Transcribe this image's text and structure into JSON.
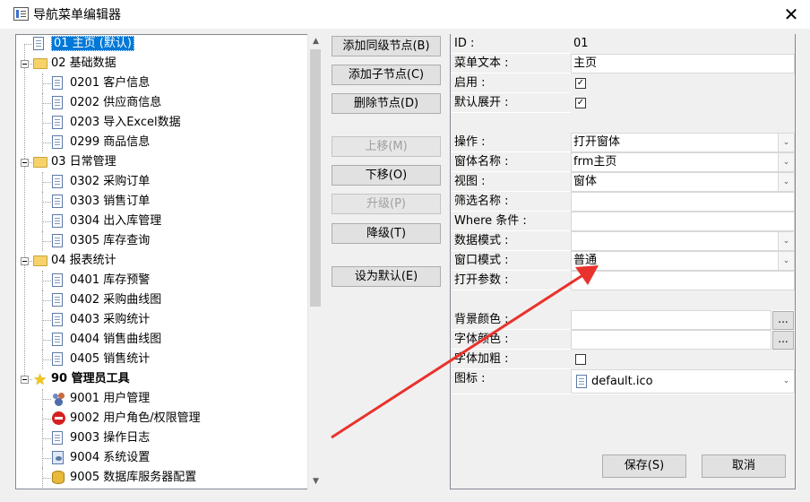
{
  "window": {
    "title": "导航菜单编辑器",
    "close_glyph": "✕"
  },
  "tree": {
    "selected": "01 主页 (默认)",
    "nodes": [
      {
        "label": "01 主页 (默认)"
      },
      {
        "label": "02 基础数据"
      },
      {
        "label": "0201 客户信息"
      },
      {
        "label": "0202 供应商信息"
      },
      {
        "label": "0203 导入Excel数据"
      },
      {
        "label": "0299 商品信息"
      },
      {
        "label": "03 日常管理"
      },
      {
        "label": "0302 采购订单"
      },
      {
        "label": "0303 销售订单"
      },
      {
        "label": "0304 出入库管理"
      },
      {
        "label": "0305 库存查询"
      },
      {
        "label": "04 报表统计"
      },
      {
        "label": "0401 库存预警"
      },
      {
        "label": "0402 采购曲线图"
      },
      {
        "label": "0403 采购统计"
      },
      {
        "label": "0404 销售曲线图"
      },
      {
        "label": "0405 销售统计"
      },
      {
        "label": "90 管理员工具"
      },
      {
        "label": "9001 用户管理"
      },
      {
        "label": "9002 用户角色/权限管理"
      },
      {
        "label": "9003 操作日志"
      },
      {
        "label": "9004 系统设置"
      },
      {
        "label": "9005 数据库服务器配置"
      }
    ]
  },
  "buttons": {
    "add_sibling": "添加同级节点(B)",
    "add_child": "添加子节点(C)",
    "delete": "删除节点(D)",
    "move_up": "上移(M)",
    "move_down": "下移(O)",
    "promote": "升级(P)",
    "demote": "降级(T)",
    "set_default": "设为默认(E)",
    "save": "保存(S)",
    "cancel": "取消"
  },
  "properties": {
    "id": {
      "name": "ID :",
      "value": "01"
    },
    "menu_text": {
      "name": "菜单文本 :",
      "value": "主页"
    },
    "enabled": {
      "name": "启用 :",
      "checked": "✓"
    },
    "expand": {
      "name": "默认展开 :",
      "checked": "✓"
    },
    "action": {
      "name": "操作 :",
      "value": "打开窗体"
    },
    "form_name": {
      "name": "窗体名称 :",
      "value": "frm主页"
    },
    "view": {
      "name": "视图 :",
      "value": "窗体"
    },
    "filter_name": {
      "name": "筛选名称 :",
      "value": ""
    },
    "where": {
      "name": "Where 条件 :",
      "value": ""
    },
    "data_mode": {
      "name": "数据模式 :",
      "value": ""
    },
    "window_mode": {
      "name": "窗口模式 :",
      "value": "普通"
    },
    "open_args": {
      "name": "打开参数 :",
      "value": ""
    },
    "back_color": {
      "name": "背景颜色 :",
      "value": ""
    },
    "fore_color": {
      "name": "字体颜色 :",
      "value": ""
    },
    "bold": {
      "name": "字体加粗 :",
      "checked": ""
    },
    "icon": {
      "name": "图标 :",
      "value": "default.ico"
    }
  },
  "colors": {
    "selection": "#0078d7",
    "annotation_arrow": "#e8322b"
  }
}
